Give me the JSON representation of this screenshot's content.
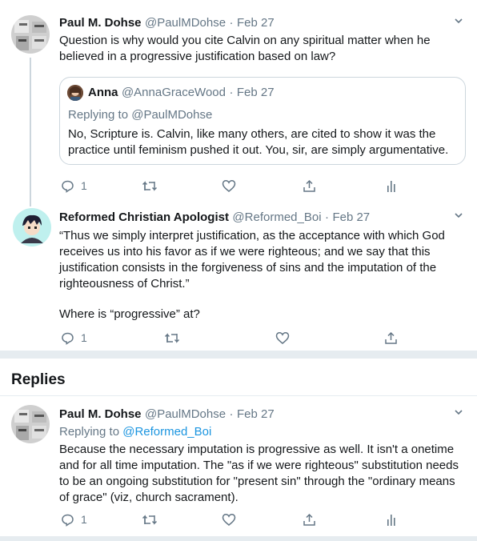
{
  "tweet1": {
    "name": "Paul M. Dohse",
    "handle": "@PaulMDohse",
    "sep": "·",
    "date": "Feb 27",
    "text": "Question is why would you cite Calvin on any spiritual matter when he believed in a progressive justification based on law?",
    "quote": {
      "name": "Anna",
      "handle": "@AnnaGraceWood",
      "date": "Feb 27",
      "replying_prefix": "Replying to",
      "replying_to": "@PaulMDohse",
      "text": "No, Scripture is. Calvin, like many others, are cited to show it was the practice until feminism pushed it out. You, sir, are simply argumentative."
    },
    "reply_count": "1"
  },
  "tweet2": {
    "name": "Reformed Christian Apologist",
    "handle": "@Reformed_Boi",
    "sep": "·",
    "date": "Feb 27",
    "text": "“Thus we simply interpret justification, as the acceptance with which God receives us into his favor as if we were righteous; and we say that this justification consists in the forgiveness of sins and the imputation of the righteousness of Christ.”",
    "text2": "Where is “progressive” at?",
    "reply_count": "1"
  },
  "replies_label": "Replies",
  "tweet3": {
    "name": "Paul M. Dohse",
    "handle": "@PaulMDohse",
    "sep": "·",
    "date": "Feb 27",
    "replying_prefix": "Replying to",
    "replying_to": "@Reformed_Boi",
    "text": "Because the necessary imputation is progressive as well. It isn't a onetime and for all time imputation. The \"as if we were righteous\" substitution needs to be an ongoing substitution for \"present sin\" through the \"ordinary means of grace\" (viz, church sacrament).",
    "reply_count": "1"
  },
  "icons": [
    "reply-icon",
    "retweet-icon",
    "like-icon",
    "share-icon",
    "analytics-icon",
    "chevron-down-icon"
  ],
  "colors": {
    "text": "#14171a",
    "muted": "#657786",
    "link": "#1b95e0",
    "divider": "#e6ecf0",
    "border": "#ccd6dd"
  }
}
